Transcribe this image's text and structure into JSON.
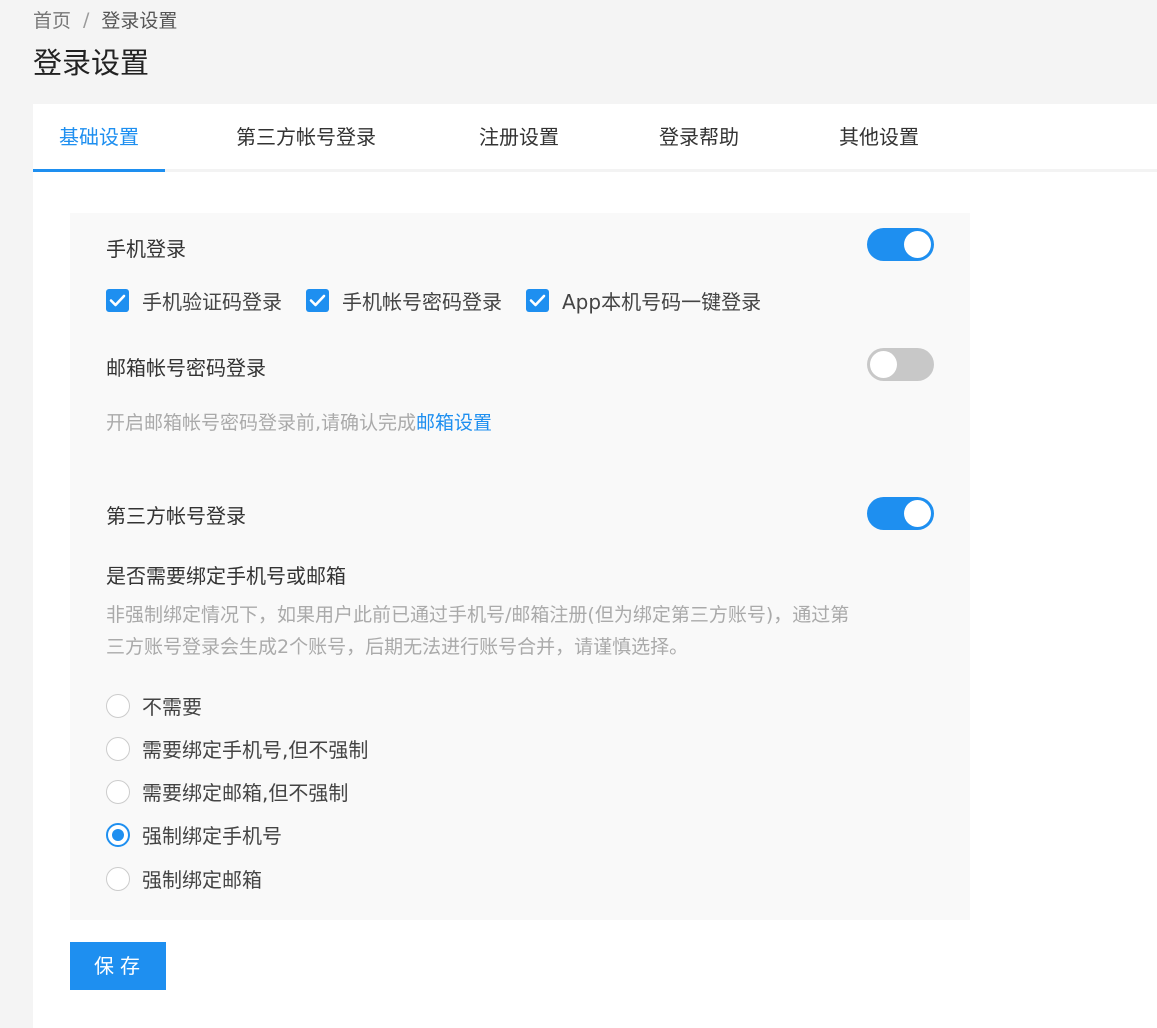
{
  "breadcrumb": {
    "home": "首页",
    "separator": "/",
    "current": "登录设置"
  },
  "page_title": "登录设置",
  "tabs": [
    {
      "label": "基础设置",
      "active": true
    },
    {
      "label": "第三方帐号登录",
      "active": false
    },
    {
      "label": "注册设置",
      "active": false
    },
    {
      "label": "登录帮助",
      "active": false
    },
    {
      "label": "其他设置",
      "active": false
    }
  ],
  "settings": {
    "phone_login": {
      "label": "手机登录",
      "enabled": true,
      "options": [
        {
          "label": "手机验证码登录",
          "checked": true
        },
        {
          "label": "手机帐号密码登录",
          "checked": true
        },
        {
          "label": "App本机号码一键登录",
          "checked": true
        }
      ]
    },
    "email_login": {
      "label": "邮箱帐号密码登录",
      "enabled": false,
      "hint": "开启邮箱帐号密码登录前,请确认完成",
      "hint_link": "邮箱设置"
    },
    "third_party_login": {
      "label": "第三方帐号登录",
      "enabled": true
    },
    "binding": {
      "question": "是否需要绑定手机号或邮箱",
      "hint_line1": "非强制绑定情况下，如果用户此前已通过手机号/邮箱注册(但为绑定第三方账号)，通过第",
      "hint_line2": "三方账号登录会生成2个账号，后期无法进行账号合并，请谨慎选择。",
      "options": [
        {
          "label": "不需要",
          "selected": false
        },
        {
          "label": "需要绑定手机号,但不强制",
          "selected": false
        },
        {
          "label": "需要绑定邮箱,但不强制",
          "selected": false
        },
        {
          "label": "强制绑定手机号",
          "selected": true
        },
        {
          "label": "强制绑定邮箱",
          "selected": false
        }
      ]
    }
  },
  "save_label": "保存",
  "colors": {
    "accent": "#1e8ff0",
    "switch_off": "#c8c8c8"
  }
}
